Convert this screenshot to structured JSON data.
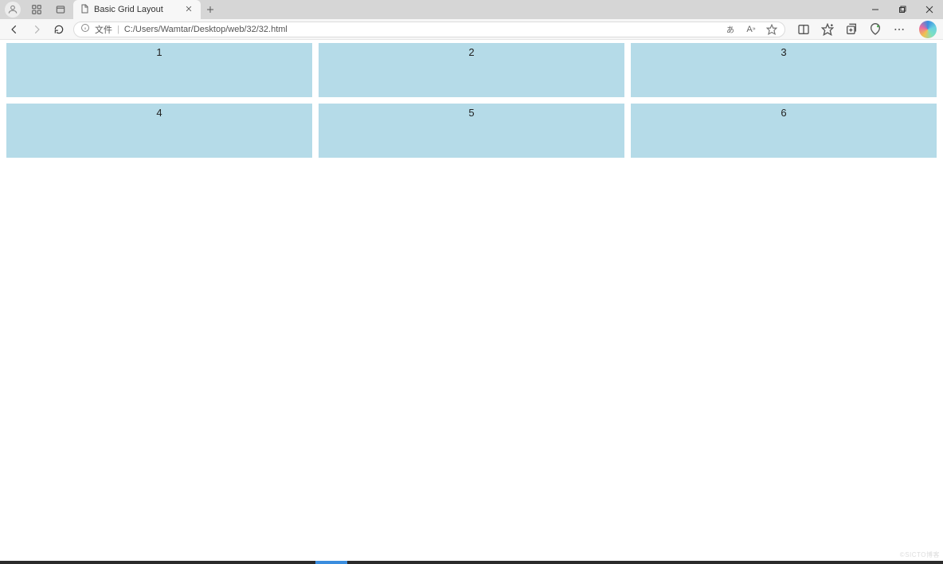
{
  "tab": {
    "title": "Basic Grid Layout"
  },
  "address": {
    "file_label": "文件",
    "url": "C:/Users/Wamtar/Desktop/web/32/32.html",
    "read_aloud_label": "あ",
    "text_size_label": "A"
  },
  "grid": {
    "cells": [
      "1",
      "2",
      "3",
      "4",
      "5",
      "6"
    ]
  },
  "watermark": "©SICTO博客"
}
